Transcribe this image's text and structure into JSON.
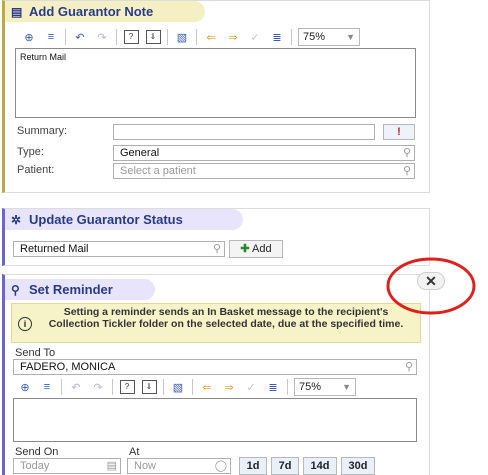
{
  "note": {
    "title": "Add Guarantor Note",
    "title_icon": "note-icon",
    "zoom": "75%",
    "body_text": "Return Mail",
    "summary_label": "Summary:",
    "summary_value": "",
    "summary_flag": "!",
    "type_label": "Type:",
    "type_value": "General",
    "patient_label": "Patient:",
    "patient_placeholder": "Select a patient"
  },
  "status": {
    "title": "Update Guarantor Status",
    "title_icon": "asterisk-icon",
    "status_value": "Returned Mail",
    "add_label": "Add"
  },
  "reminder": {
    "title": "Set Reminder",
    "title_icon": "reminder-icon",
    "info_text": "Setting a reminder sends an In Basket message to the recipient's Collection Tickler folder on the selected date, due at the specified time.",
    "send_to_label": "Send To",
    "send_to_value": "FADERO, MONICA",
    "zoom": "75%",
    "send_on_label": "Send On",
    "send_on_placeholder": "Today",
    "at_label": "At",
    "at_placeholder": "Now",
    "quick_dates": [
      "1d",
      "7d",
      "14d",
      "30d"
    ]
  },
  "colors": {
    "note_accent": "#b9ab45",
    "note_title_bg": "#f5f0c4",
    "section_accent": "#6b63d6",
    "section_title_bg": "#e7e4fb",
    "info_bg": "#f7f3c9",
    "annotation_circle": "#e0201e"
  }
}
